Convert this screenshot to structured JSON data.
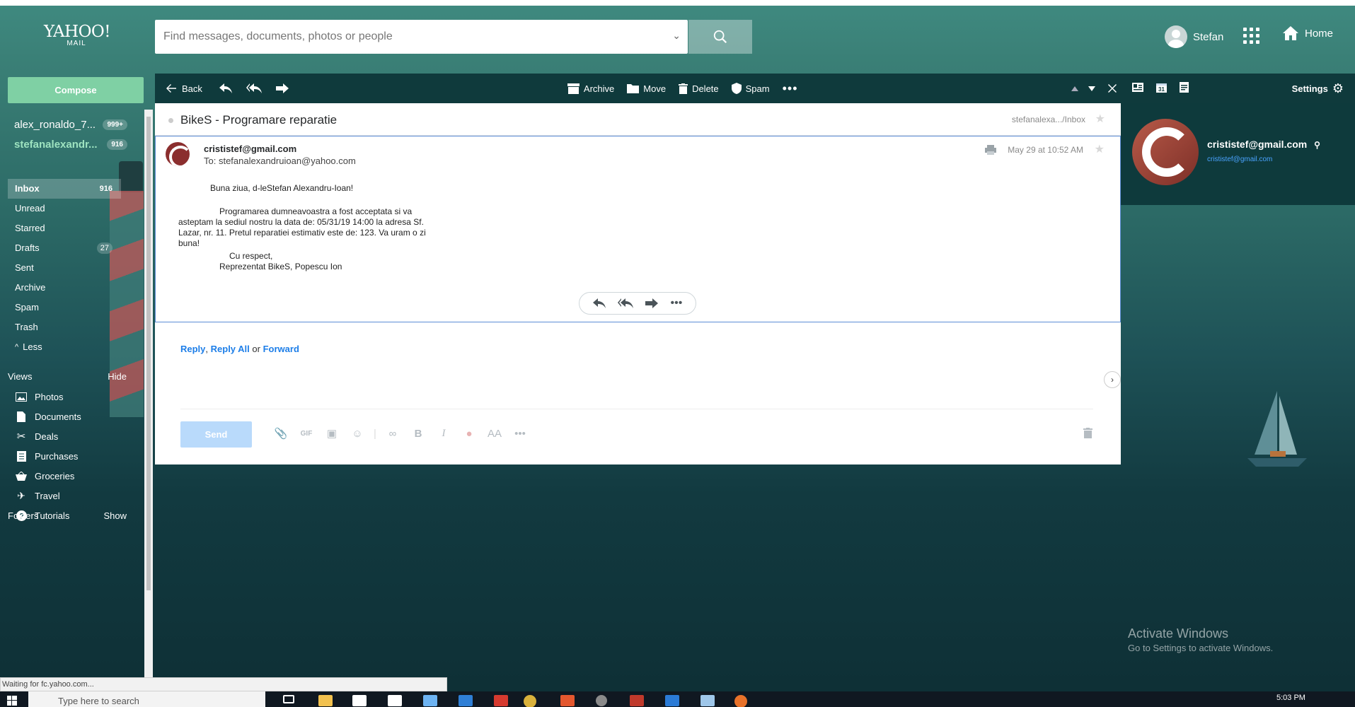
{
  "header": {
    "logo_line1": "YAHOO!",
    "logo_line2": "MAIL",
    "search_placeholder": "Find messages, documents, photos or people",
    "user_name": "Stefan",
    "home_label": "Home"
  },
  "sidebar": {
    "compose_label": "Compose",
    "accounts": [
      {
        "name": "alex_ronaldo_7...",
        "count": "999+"
      },
      {
        "name": "stefanalexandr...",
        "count": "916"
      }
    ],
    "folders": [
      {
        "label": "Inbox",
        "count": "916"
      },
      {
        "label": "Unread",
        "count": ""
      },
      {
        "label": "Starred",
        "count": ""
      },
      {
        "label": "Drafts",
        "count": "27"
      },
      {
        "label": "Sent",
        "count": ""
      },
      {
        "label": "Archive",
        "count": ""
      },
      {
        "label": "Spam",
        "count": ""
      },
      {
        "label": "Trash",
        "count": ""
      }
    ],
    "less_label": "Less",
    "views_label": "Views",
    "views_toggle": "Hide",
    "views": [
      {
        "label": "Photos",
        "icon": "photos-icon"
      },
      {
        "label": "Documents",
        "icon": "documents-icon"
      },
      {
        "label": "Deals",
        "icon": "deals-icon"
      },
      {
        "label": "Purchases",
        "icon": "purchases-icon"
      },
      {
        "label": "Groceries",
        "icon": "groceries-icon"
      },
      {
        "label": "Travel",
        "icon": "travel-icon"
      },
      {
        "label": "Tutorials",
        "icon": "tutorials-icon"
      }
    ],
    "folders_label": "Folders",
    "folders_toggle": "Show"
  },
  "toolbar": {
    "back_label": "Back",
    "archive_label": "Archive",
    "move_label": "Move",
    "delete_label": "Delete",
    "spam_label": "Spam",
    "settings_label": "Settings"
  },
  "message": {
    "subject": "BikeS - Programare reparatie",
    "folder_path": "stefanalexa.../Inbox",
    "from": "crististef@gmail.com",
    "to": "To: stefanalexandruioan@yahoo.com",
    "date": "May 29 at 10:52 AM",
    "body_greeting": "Buna ziua, d-leStefan Alexandru-Ioan!",
    "body_para": "Programarea dumneavoastra a fost acceptata si va asteptam la sediul nostru la data de: 05/31/19 14:00 la adresa Sf. Lazar, nr. 11. Pretul reparatiei estimativ este de: 123. Va uram o zi buna!",
    "body_closing": "Cu respect,",
    "body_signature": "Reprezentat BikeS, Popescu Ion"
  },
  "reply": {
    "reply": "Reply",
    "reply_all": "Reply All",
    "or": "or",
    "forward": "Forward",
    "send_label": "Send"
  },
  "contact": {
    "email": "crististef@gmail.com",
    "link": "crististef@gmail.com"
  },
  "windows": {
    "activate_title": "Activate Windows",
    "activate_sub": "Go to Settings to activate Windows.",
    "status": "Waiting for fc.yahoo.com...",
    "taskbar_search": "Type here to search",
    "clock": "5:03 PM"
  }
}
